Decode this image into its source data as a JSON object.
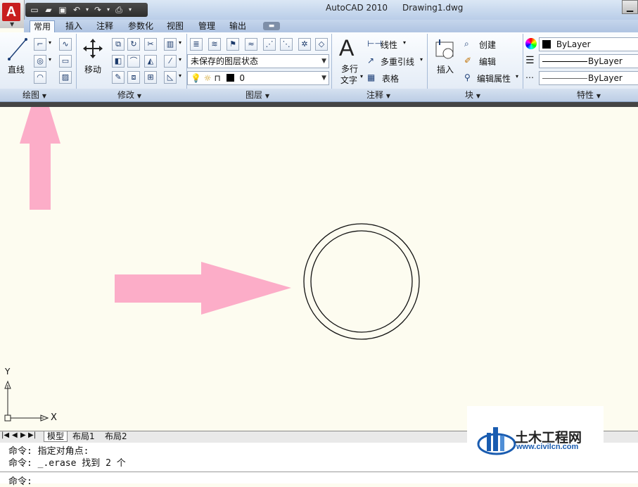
{
  "title": {
    "app": "AutoCAD 2010",
    "document": "Drawing1.dwg",
    "app_logo_letter": "A"
  },
  "tabs": [
    {
      "label": "常用",
      "active": true
    },
    {
      "label": "插入"
    },
    {
      "label": "注释"
    },
    {
      "label": "参数化"
    },
    {
      "label": "视图"
    },
    {
      "label": "管理"
    },
    {
      "label": "输出"
    }
  ],
  "ribbon": {
    "draw": {
      "line_label": "直线"
    },
    "modify": {
      "move_label": "移动"
    },
    "layers": {
      "layer_state": "未保存的图层状态",
      "current_layer": "0"
    },
    "annotation": {
      "mtext_label_1": "多行",
      "mtext_label_2": "文字",
      "dim_label": "线性",
      "mleader_label": "多重引线",
      "table_label": "表格"
    },
    "block": {
      "insert_label": "插入",
      "create_label": "创建",
      "edit_label": "编辑",
      "edit_attr_label": "编辑属性"
    },
    "properties": {
      "color": "ByLayer",
      "linetype": "ByLayer",
      "lineweight": "ByLayer"
    }
  },
  "panel_titles": {
    "draw": "绘图",
    "modify": "修改",
    "layers": "图层",
    "annotation": "注释",
    "block": "块",
    "properties": "特性"
  },
  "ucs": {
    "x": "X",
    "y": "Y"
  },
  "layout_tabs": [
    {
      "label": "模型",
      "active": true
    },
    {
      "label": "布局1"
    },
    {
      "label": "布局2"
    }
  ],
  "command": {
    "line1": "命令: 指定对角点:",
    "line2": "命令: _.erase 找到 2 个",
    "prompt": "命令:"
  },
  "watermark": {
    "name": "土木工程网",
    "url": "www.civilcn.com"
  },
  "colors": {
    "arrow": "#fcadc8",
    "canvas": "#fdfcf0",
    "logo_red": "#c81e1e"
  }
}
